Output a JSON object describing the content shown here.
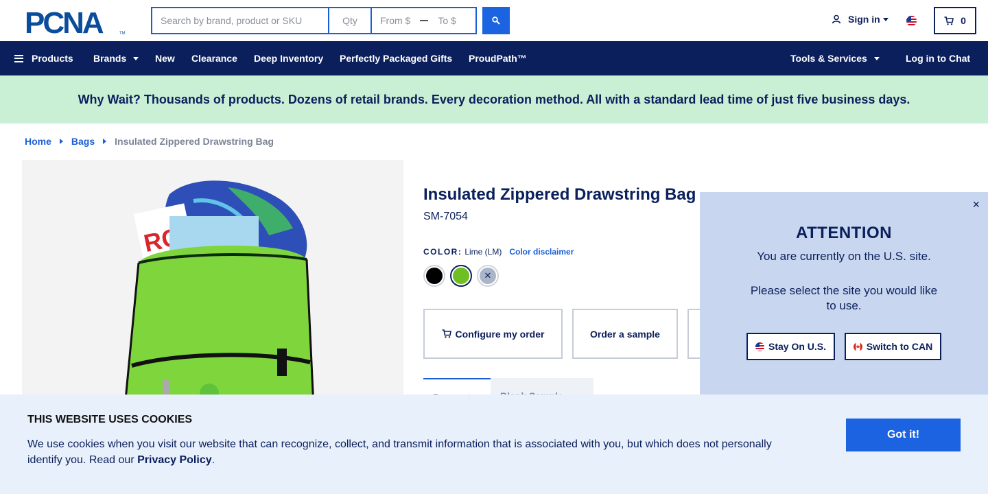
{
  "header": {
    "logo_text": "PCNA",
    "search_placeholder": "Search by brand, product or SKU",
    "qty_placeholder": "Qty",
    "from_placeholder": "From $",
    "to_placeholder": "To $",
    "sign_in": "Sign in",
    "cart_count": "0"
  },
  "nav": {
    "products": "Products",
    "brands": "Brands",
    "new": "New",
    "clearance": "Clearance",
    "deep_inventory": "Deep Inventory",
    "gifts": "Perfectly Packaged Gifts",
    "proudpath": "ProudPath™",
    "tools": "Tools & Services",
    "chat": "Log in to Chat"
  },
  "promo": "Why Wait? Thousands of products. Dozens of retail brands. Every decoration method. All with a standard lead time of just five business days.",
  "breadcrumb": {
    "home": "Home",
    "bags": "Bags",
    "current": "Insulated Zippered Drawstring Bag"
  },
  "product": {
    "title": "Insulated Zippered Drawstring Bag",
    "sku": "SM-7054",
    "color_label": "COLOR:",
    "color_value": "Lime (LM)",
    "color_disclaimer": "Color disclaimer",
    "swatches": [
      {
        "name": "Black",
        "color": "#000000"
      },
      {
        "name": "Lime",
        "color": "#6fbe22"
      },
      {
        "name": "Unavailable",
        "color": "#aab5c8"
      }
    ],
    "configure": "Configure my order",
    "sample": "Order a sample",
    "tab_active": "Request",
    "tab_inactive": "Blank Sample"
  },
  "attention": {
    "close": "×",
    "title": "ATTENTION",
    "message": "You are currently on the U.S. site.",
    "message2": "Please select the site you would like to use.",
    "stay": "Stay On U.S.",
    "switch": "Switch to CAN"
  },
  "cookie": {
    "title": "THIS WEBSITE USES COOKIES",
    "text": "We use cookies when you visit our website that can recognize, collect, and transmit information that is associated with you, but which does not personally identify you. Read our ",
    "link": "Privacy Policy",
    "end": ".",
    "button": "Got it!"
  },
  "colors": {
    "navy": "#0a1f5c",
    "blue": "#1b63e0",
    "promo_bg": "#c9f0d5",
    "cookie_bg": "#e8f0fb",
    "popup_bg": "#c8d7ef"
  }
}
